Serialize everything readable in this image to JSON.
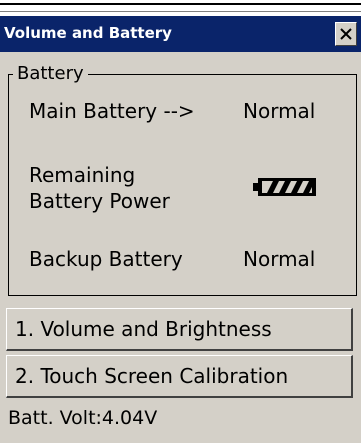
{
  "window": {
    "title": "Volume and Battery",
    "close_symbol": "×"
  },
  "battery": {
    "group_label": "Battery",
    "main_label": "Main Battery -->",
    "main_value": "Normal",
    "remaining_label_line1": "Remaining",
    "remaining_label_line2": "Battery Power",
    "remaining_icon": "battery-full-icon",
    "backup_label": "Backup Battery",
    "backup_value": "Normal"
  },
  "buttons": {
    "volume_brightness": "1. Volume and Brightness",
    "touch_calibration": "2. Touch Screen Calibration"
  },
  "status": {
    "batt_volt": "Batt. Volt:4.04V"
  },
  "colors": {
    "titlebar": "#0a246a",
    "window_bg": "#d4d0c8"
  }
}
